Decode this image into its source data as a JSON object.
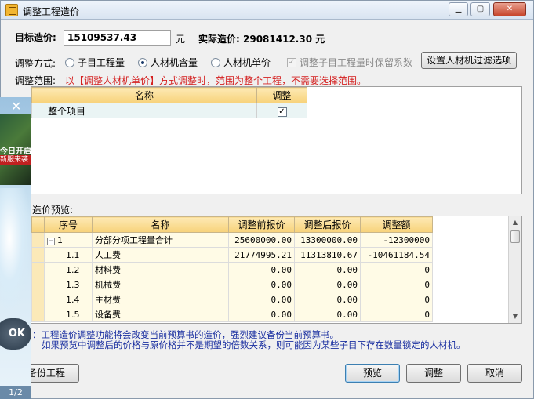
{
  "window": {
    "title": "调整工程造价"
  },
  "target_price": {
    "label": "目标造价:",
    "value": "15109537.43",
    "unit": "元"
  },
  "actual_price": {
    "label": "实际造价:",
    "value": "29081412.30",
    "unit": "元"
  },
  "adjust_mode": {
    "label": "调整方式:",
    "options": [
      "子目工程量",
      "人材机含量",
      "人材机单价"
    ],
    "selected": "人材机含量",
    "keep_coef_label": "调整子目工程量时保留系数",
    "filter_button": "设置人材机过滤选项"
  },
  "adjust_range": {
    "label": "调整范围:",
    "note": "以【调整人材机单价】方式调整时，范围为整个工程，不需要选择范围。",
    "columns": [
      "名称",
      "调整"
    ],
    "rows": [
      {
        "name": "整个项目",
        "checked": true
      }
    ]
  },
  "preview": {
    "label": "造价预览:",
    "columns": [
      "序号",
      "名称",
      "调整前报价",
      "调整后报价",
      "调整额"
    ],
    "rows": [
      {
        "idx": "1",
        "name": "分部分项工程量合计",
        "before": "25600000.00",
        "after": "13300000.00",
        "diff": "-12300000"
      },
      {
        "idx": "1.1",
        "name": "人工费",
        "before": "21774995.21",
        "after": "11313810.67",
        "diff": "-10461184.54"
      },
      {
        "idx": "1.2",
        "name": "材料费",
        "before": "0.00",
        "after": "0.00",
        "diff": "0"
      },
      {
        "idx": "1.3",
        "name": "机械费",
        "before": "0.00",
        "after": "0.00",
        "diff": "0"
      },
      {
        "idx": "1.4",
        "name": "主材费",
        "before": "0.00",
        "after": "0.00",
        "diff": "0"
      },
      {
        "idx": "1.5",
        "name": "设备费",
        "before": "0.00",
        "after": "0.00",
        "diff": "0"
      }
    ]
  },
  "note": {
    "line1": "：工程造价调整功能将会改变当前预算书的造价，强烈建议备份当前预算书。",
    "line2": "如果预览中调整后的价格与原价格并不是期望的倍数关系，则可能因为某些子目下存在数量锁定的人材机。"
  },
  "buttons": {
    "backup": "备份工程",
    "preview": "预览",
    "adjust": "调整",
    "cancel": "取消"
  },
  "overlay": {
    "pic_text": "今日开启",
    "pic_sub": "新服来袭",
    "badge": "OK",
    "pager": "1/2"
  }
}
